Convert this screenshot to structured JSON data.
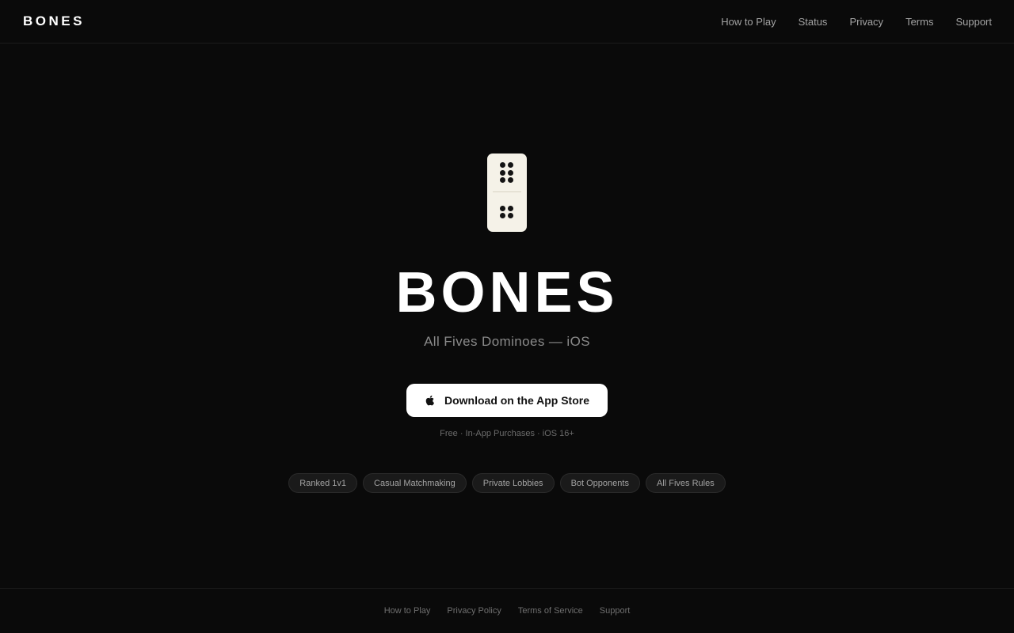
{
  "header": {
    "brand": "BONES",
    "nav": [
      "How to Play",
      "Status",
      "Privacy",
      "Terms",
      "Support"
    ]
  },
  "hero": {
    "domino": {
      "top_pips": 6,
      "bottom_pips": 4
    },
    "title": "BONES",
    "subtitle": "All Fives Dominoes — iOS",
    "cta_label": "Download on the App Store",
    "cta_icon": "apple-icon",
    "fineprint": "Free · In-App Purchases · iOS 16+"
  },
  "features": [
    "Ranked 1v1",
    "Casual Matchmaking",
    "Private Lobbies",
    "Bot Opponents",
    "All Fives Rules"
  ],
  "footer": {
    "links": [
      "How to Play",
      "Privacy Policy",
      "Terms of Service",
      "Support"
    ]
  },
  "colors": {
    "background": "#0a0a0a",
    "tile": "#f5f2e8",
    "pip": "#141414",
    "cta_background": "#ffffff"
  }
}
